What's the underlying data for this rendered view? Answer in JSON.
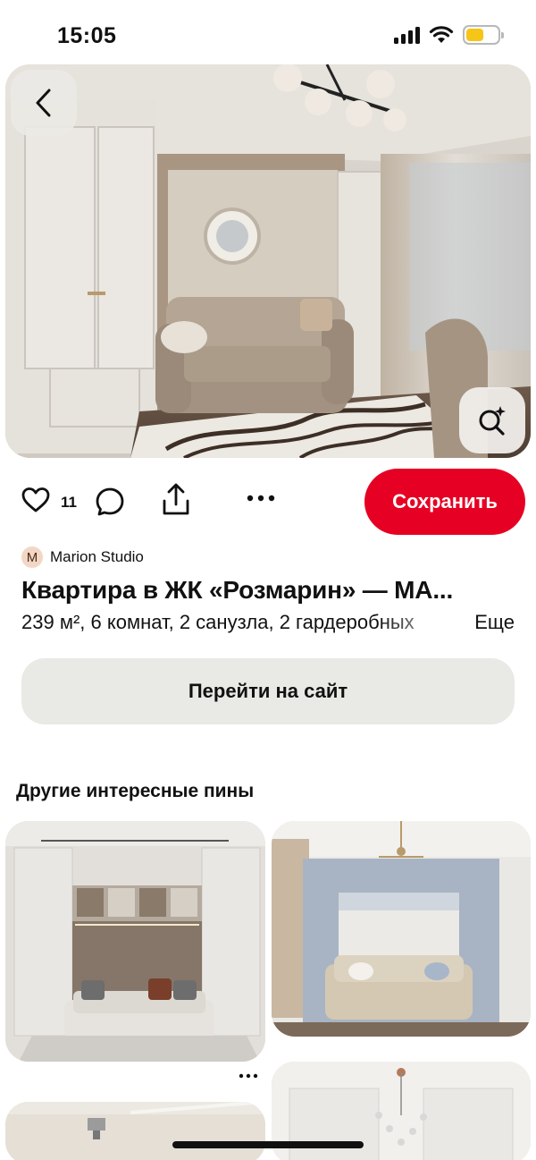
{
  "status_bar": {
    "time": "15:05",
    "icons": [
      "cellular-signal-icon",
      "wifi-icon",
      "battery-icon"
    ],
    "battery_level": 0.55
  },
  "hero": {
    "back_icon": "chevron-left-icon",
    "visual_search_icon": "lens-sparkle-icon"
  },
  "actions": {
    "like_icon": "heart-icon",
    "like_count": "11",
    "comment_icon": "comment-icon",
    "share_icon": "share-icon",
    "more_icon": "more-horizontal-icon",
    "save_label": "Сохранить"
  },
  "pin": {
    "author_initial": "M",
    "author_name": "Marion Studio",
    "title": "Квартира в ЖК «Розмарин» — МА...",
    "description": "239 м², 6 комнат, 2 санузла, 2 гардеробных",
    "more_label": "Еще",
    "visit_label": "Перейти на сайт"
  },
  "related": {
    "heading": "Другие интересные пины",
    "more_icon": "more-horizontal-icon"
  },
  "colors": {
    "accent": "#e60023",
    "secondary_button": "#e9e9e5",
    "battery": "#f5c518"
  }
}
